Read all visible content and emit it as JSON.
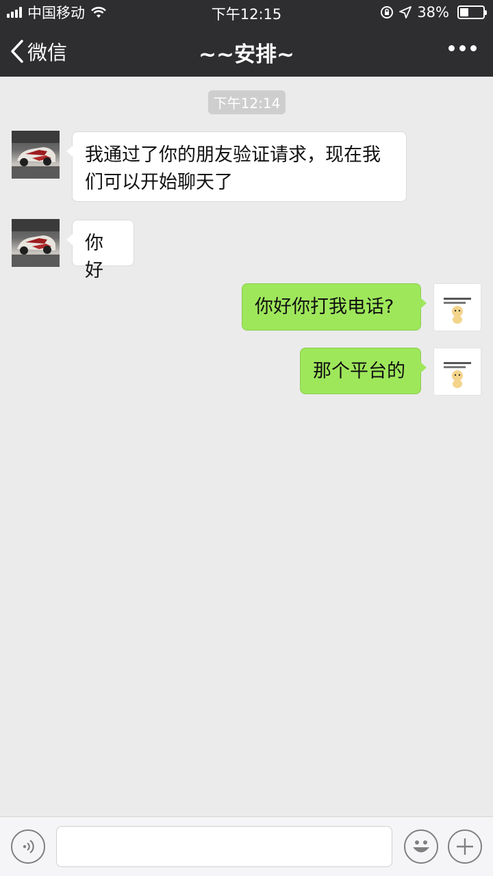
{
  "status_bar": {
    "carrier": "中国移动",
    "time": "下午12:15",
    "battery": "38%",
    "battery_level": 0.38,
    "icons": [
      "signal-icon",
      "wifi-icon",
      "orientation-lock-icon",
      "location-icon",
      "battery-icon"
    ]
  },
  "nav": {
    "back_label": "微信",
    "title": "~~安排~",
    "icons": [
      "back-chevron-icon",
      "more-icon"
    ]
  },
  "chat": {
    "timestamp": "下午12:14",
    "messages": [
      {
        "side": "left",
        "text": "我通过了你的朋友验证请求，现在我们可以开始聊天了",
        "line1": "我通过了你的朋友验证请求，现在我",
        "line2": "们可以开始聊天了"
      },
      {
        "side": "left",
        "text": "你好"
      },
      {
        "side": "right",
        "text": "你好你打我电话?"
      },
      {
        "side": "right",
        "text": "那个平台的"
      }
    ]
  },
  "input_bar": {
    "text_value": "",
    "icons": [
      "voice-icon",
      "emoji-icon",
      "plus-icon"
    ]
  },
  "colors": {
    "header_bg": "#2e2e31",
    "chat_bg": "#ebebeb",
    "own_bubble": "#9ee75b",
    "other_bubble": "#ffffff"
  }
}
